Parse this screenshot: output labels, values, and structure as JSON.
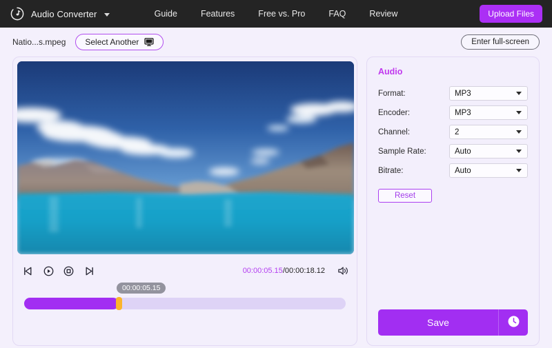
{
  "navbar": {
    "logo_icon": "music-note-circle-icon",
    "brand": "Audio Converter",
    "caret_icon": "chevron-down-icon",
    "links": [
      {
        "label": "Guide"
      },
      {
        "label": "Features"
      },
      {
        "label": "Free vs. Pro"
      },
      {
        "label": "FAQ"
      },
      {
        "label": "Review"
      }
    ],
    "upload_label": "Upload Files",
    "accent": "#ab2ff5",
    "background": "#242424"
  },
  "toolbar": {
    "file_name": "Natio...s.mpeg",
    "select_another_label": "Select Another",
    "select_another_icon": "monitor-icon",
    "fullscreen_label": "Enter full-screen"
  },
  "player": {
    "controls": [
      {
        "name": "previous-frame-button",
        "icon": "step-backward-icon"
      },
      {
        "name": "play-button",
        "icon": "play-circle-icon"
      },
      {
        "name": "stop-button",
        "icon": "stop-circle-icon"
      },
      {
        "name": "next-frame-button",
        "icon": "step-forward-icon"
      }
    ],
    "current_time": "00:00:05.15",
    "time_separator": "/",
    "total_time": "00:00:18.12",
    "volume_icon": "speaker-icon",
    "tooltip_time": "00:00:05.15",
    "progress_percent": 29.5,
    "progress_color": "#a22ef2",
    "handle_color": "#fbb42b",
    "track_color": "#ded3f6",
    "video_alt": "Turquoise mountain lake under blue sky with clouds"
  },
  "settings": {
    "title": "Audio",
    "title_color": "#c038ee",
    "fields": [
      {
        "label": "Format:",
        "value": "MP3"
      },
      {
        "label": "Encoder:",
        "value": "MP3"
      },
      {
        "label": "Channel:",
        "value": "2"
      },
      {
        "label": "Sample Rate:",
        "value": "Auto"
      },
      {
        "label": "Bitrate:",
        "value": "Auto"
      }
    ],
    "reset_label": "Reset",
    "save_label": "Save",
    "save_extra_icon": "clock-icon"
  }
}
